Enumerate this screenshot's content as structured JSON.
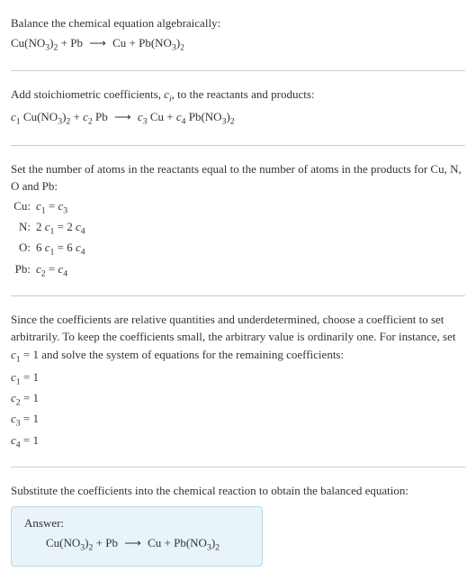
{
  "section1": {
    "intro": "Balance the chemical equation algebraically:"
  },
  "section2": {
    "intro": "Add stoichiometric coefficients, ",
    "intro2": ", to the reactants and products:"
  },
  "section3": {
    "intro": "Set the number of atoms in the reactants equal to the number of atoms in the products for Cu, N, O and Pb:",
    "rows": [
      {
        "label": "Cu:",
        "eq_lhs": "c",
        "eq_lhs_sub": "1",
        "mid": " = ",
        "eq_rhs": "c",
        "eq_rhs_sub": "3"
      },
      {
        "label": "N:",
        "prefix": "2 ",
        "eq_lhs": "c",
        "eq_lhs_sub": "1",
        "mid": " = 2 ",
        "eq_rhs": "c",
        "eq_rhs_sub": "4"
      },
      {
        "label": "O:",
        "prefix": "6 ",
        "eq_lhs": "c",
        "eq_lhs_sub": "1",
        "mid": " = 6 ",
        "eq_rhs": "c",
        "eq_rhs_sub": "4"
      },
      {
        "label": "Pb:",
        "eq_lhs": "c",
        "eq_lhs_sub": "2",
        "mid": " = ",
        "eq_rhs": "c",
        "eq_rhs_sub": "4"
      }
    ]
  },
  "section4": {
    "intro_a": "Since the coefficients are relative quantities and underdetermined, choose a coefficient to set arbitrarily. To keep the coefficients small, the arbitrary value is ordinarily one. For instance, set ",
    "intro_b": " = 1 and solve the system of equations for the remaining coefficients:",
    "coeffs": [
      {
        "c": "c",
        "sub": "1",
        "val": " = 1"
      },
      {
        "c": "c",
        "sub": "2",
        "val": " = 1"
      },
      {
        "c": "c",
        "sub": "3",
        "val": " = 1"
      },
      {
        "c": "c",
        "sub": "4",
        "val": " = 1"
      }
    ]
  },
  "section5": {
    "intro": "Substitute the coefficients into the chemical reaction to obtain the balanced equation:",
    "answer_label": "Answer:"
  },
  "chem": {
    "CuNO3_a": "Cu(NO",
    "CuNO3_b": ")",
    "PbNO3_a": "Pb(NO",
    "PbNO3_b": ")",
    "three": "3",
    "two": "2",
    "plus": " + ",
    "Pb": "Pb",
    "Cu": "Cu",
    "arrow": "⟶",
    "c": "c",
    "c1": "1",
    "c2": "2",
    "c3": "3",
    "c4": "4",
    "ci": "i",
    "sp": " "
  }
}
